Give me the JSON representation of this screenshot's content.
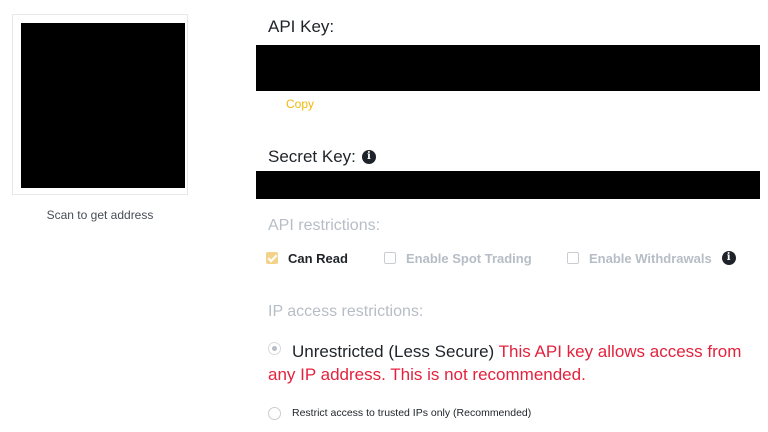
{
  "qr": {
    "caption": "Scan to get address"
  },
  "api_key": {
    "label": "API Key:",
    "copy_label": "Copy"
  },
  "secret_key": {
    "label": "Secret Key:",
    "info_icon": "info-icon"
  },
  "api_restrictions": {
    "title": "API restrictions:",
    "options": [
      {
        "label": "Can Read",
        "checked": true,
        "enabled": true
      },
      {
        "label": "Enable Spot Trading",
        "checked": false,
        "enabled": false
      },
      {
        "label": "Enable Withdrawals",
        "checked": false,
        "enabled": false
      }
    ]
  },
  "ip_restrictions": {
    "title": "IP access restrictions:",
    "unrestricted_label": "Unrestricted (Less Secure)",
    "unrestricted_warning": "This API key allows access from any IP address. This is not recommended.",
    "restrict_label": "Restrict access to trusted IPs only (Recommended)"
  },
  "colors": {
    "accent": "#f0b90b",
    "warning": "#e3223d",
    "muted": "#b7bdc6"
  }
}
